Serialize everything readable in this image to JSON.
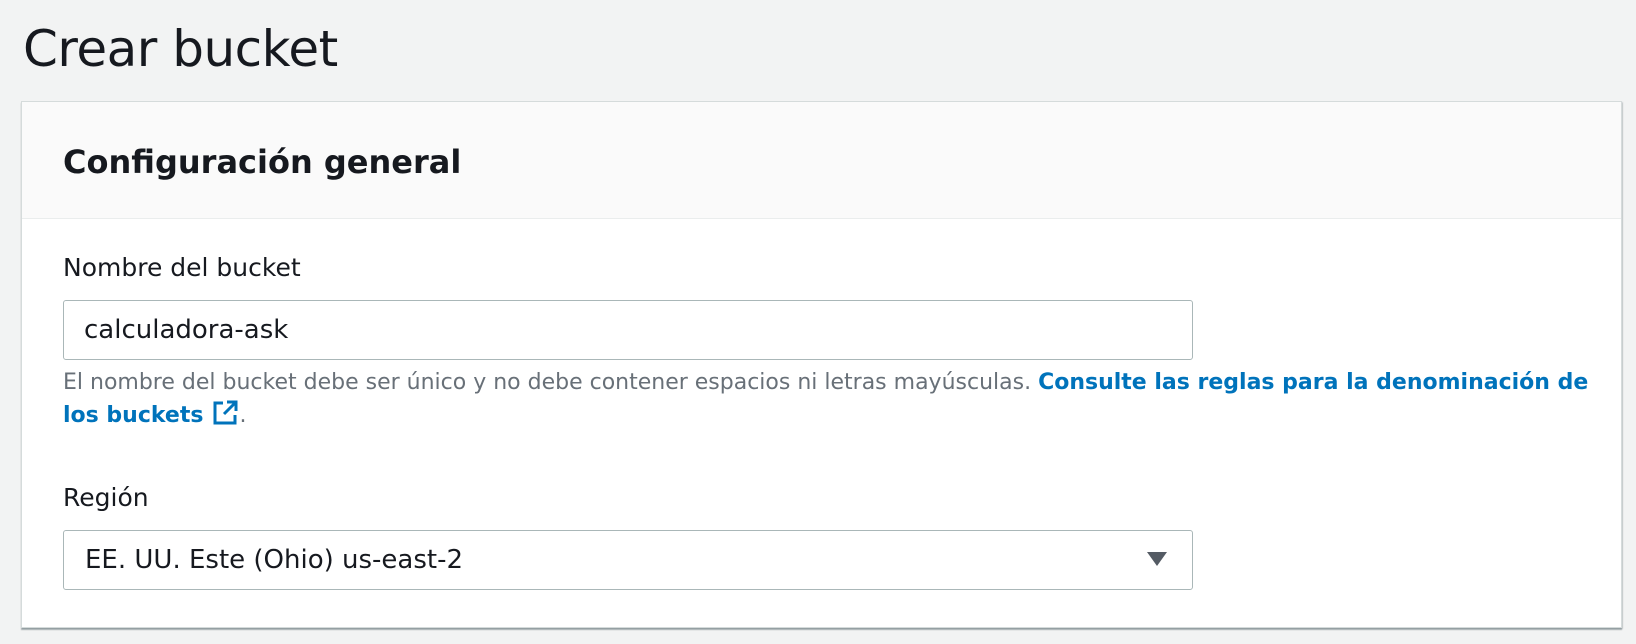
{
  "page": {
    "title": "Crear bucket"
  },
  "general_config": {
    "heading": "Configuración general",
    "bucket_name": {
      "label": "Nombre del bucket",
      "value": "calculadora-ask",
      "description": "El nombre del bucket debe ser único y no debe contener espacios ni letras mayúsculas. ",
      "link_text": "Consulte las reglas para la denominación de los buckets",
      "link_icon": "external-link-icon",
      "trailing": "."
    },
    "region": {
      "label": "Región",
      "selected": "EE. UU. Este (Ohio) us-east-2",
      "icon": "caret-down-icon"
    }
  },
  "colors": {
    "page_background": "#f2f3f3",
    "link": "#0073bb",
    "text": "#16191f",
    "muted_text": "#687078",
    "border": "#aab7b8"
  }
}
